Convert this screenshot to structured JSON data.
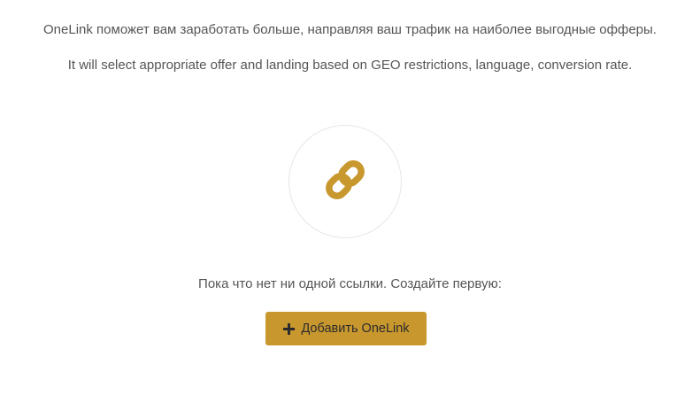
{
  "intro": {
    "ru": "OneLink поможет вам заработать больше, направляя ваш трафик на наиболее выгодные офферы.",
    "en": "It will select appropriate offer and landing based on GEO restrictions, language, conversion rate."
  },
  "empty_state": {
    "icon": "link-icon",
    "message": "Пока что нет ни одной ссылки. Создайте первую:"
  },
  "add_button": {
    "icon": "plus-icon",
    "label": "Добавить OneLink"
  },
  "colors": {
    "accent": "#c8982f",
    "text": "#555555",
    "circle_border": "#e6e6e6"
  }
}
